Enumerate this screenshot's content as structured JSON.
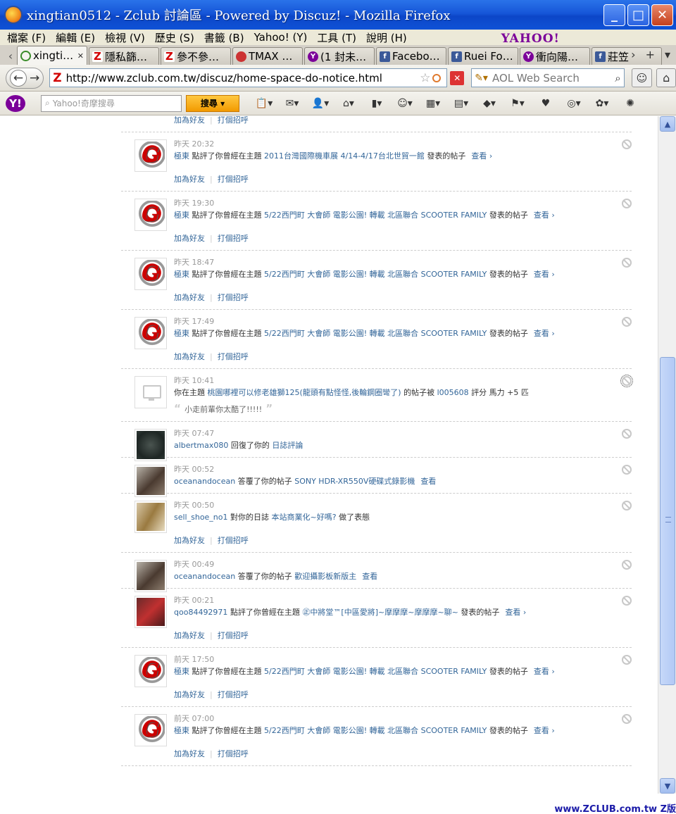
{
  "window": {
    "title": "xingtian0512 - Zclub 討論區 - Powered by Discuz! - Mozilla Firefox"
  },
  "menu": [
    "檔案 (F)",
    "編輯 (E)",
    "檢視 (V)",
    "歷史 (S)",
    "書籤 (B)",
    "Yahoo! (Y)",
    "工具 (T)",
    "說明 (H)"
  ],
  "yahoo_brand": "YAHOO!",
  "tabs": [
    {
      "label": "xingti…",
      "icon": "loading"
    },
    {
      "label": "隱私篩…",
      "icon": "z"
    },
    {
      "label": "參不參…",
      "icon": "z"
    },
    {
      "label": "TMAX …",
      "icon": "tmax"
    },
    {
      "label": "(1 封未…",
      "icon": "yh"
    },
    {
      "label": "Facebo…",
      "icon": "fb"
    },
    {
      "label": "Ruei Fo…",
      "icon": "fb"
    },
    {
      "label": "衝向陽…",
      "icon": "yh"
    },
    {
      "label": "莊笠",
      "icon": "fb"
    }
  ],
  "nav": {
    "url": "http://www.zclub.com.tw/discuz/home-space-do-notice.html",
    "search_placeholder": "AOL Web Search"
  },
  "ytoolbar": {
    "search_placeholder": "Yahoo!奇摩搜尋",
    "search_button": "搜尋"
  },
  "labels": {
    "add_friend": "加為好友",
    "greet": "打個招呼",
    "view": "查看 ›",
    "view_plain": "查看"
  },
  "notices": [
    {
      "time": "",
      "avatar": "gmax",
      "parts": [],
      "actions": true
    },
    {
      "time": "昨天 20:32",
      "avatar": "gmax",
      "user": "極東",
      "pre": "點評了你曾經在主題",
      "link": "2011台灣國際機車展 4/14-4/17台北世貿一館",
      "post": "發表的帖子",
      "view": true,
      "actions": true
    },
    {
      "time": "昨天 19:30",
      "avatar": "gmax",
      "user": "極東",
      "pre": "點評了你曾經在主題",
      "link": "5/22西門町 大會師 電影公園! 轉載 北區聯合 SCOOTER FAMILY",
      "post": "發表的帖子",
      "view": true,
      "actions": true
    },
    {
      "time": "昨天 18:47",
      "avatar": "gmax",
      "user": "極東",
      "pre": "點評了你曾經在主題",
      "link": "5/22西門町 大會師 電影公園! 轉載 北區聯合 SCOOTER FAMILY",
      "post": "發表的帖子",
      "view": true,
      "actions": true
    },
    {
      "time": "昨天 17:49",
      "avatar": "gmax",
      "user": "極東",
      "pre": "點評了你曾經在主題",
      "link": "5/22西門町 大會師 電影公園! 轉載 北區聯合 SCOOTER FAMILY",
      "post": "發表的帖子",
      "view": true,
      "actions": true
    },
    {
      "time": "昨天 10:41",
      "avatar": "monitor",
      "user": "",
      "pre": "你在主題",
      "link": "桃園哪裡可以修老雄獅125(龍頭有點怪怪,後輪鋼圈彎了)",
      "post": "的帖子被",
      "link2": "l005608",
      "post2": "評分 馬力 +5 匹",
      "quote": "小走前輩你太酷了!!!!!",
      "focused": true
    },
    {
      "time": "昨天 07:47",
      "avatar": "dark",
      "user": "albertmax080",
      "pre": "回復了你的",
      "link": "日誌評論",
      "post": ""
    },
    {
      "time": "昨天 00:52",
      "avatar": "bike",
      "user": "oceanandocean",
      "pre": "答覆了你的帖子",
      "link": "SONY HDR-XR550V硬碟式錄影機",
      "post": "",
      "view_plain": true
    },
    {
      "time": "昨天 00:50",
      "avatar": "gold",
      "user": "sell_shoe_no1",
      "pre": "對你的日誌",
      "link": "本站商業化~好嗎?",
      "post": "做了表態",
      "actions": true
    },
    {
      "time": "昨天 00:49",
      "avatar": "bike",
      "user": "oceanandocean",
      "pre": "答覆了你的帖子",
      "link": "歡迎攝影板新版主",
      "post": "",
      "view_plain": true
    },
    {
      "time": "昨天 00:21",
      "avatar": "red",
      "user": "qoo84492971",
      "pre": "點評了你曾經在主題",
      "link": "㊣中將堂™[中區愛將]~摩摩摩~摩摩摩~聊~",
      "post": "發表的帖子",
      "view": true,
      "actions": true
    },
    {
      "time": "前天 17:50",
      "avatar": "gmax",
      "user": "極東",
      "pre": "點評了你曾經在主題",
      "link": "5/22西門町 大會師 電影公園! 轉載 北區聯合 SCOOTER FAMILY",
      "post": "發表的帖子",
      "view": true,
      "actions": true
    },
    {
      "time": "前天 07:00",
      "avatar": "gmax",
      "user": "極東",
      "pre": "點評了你曾經在主題",
      "link": "5/22西門町 大會師 電影公園! 轉載 北區聯合 SCOOTER FAMILY",
      "post": "發表的帖子",
      "view": true,
      "actions": true
    }
  ],
  "watermark": "www.ZCLUB.com.tw Z版"
}
